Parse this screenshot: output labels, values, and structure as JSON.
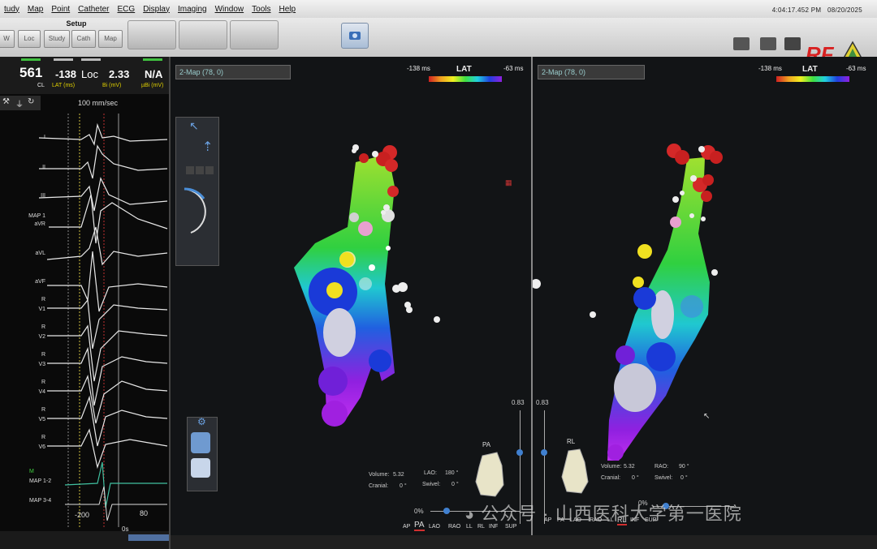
{
  "menu": [
    "tudy",
    "Map",
    "Point",
    "Catheter",
    "ECG",
    "Display",
    "Imaging",
    "Window",
    "Tools",
    "Help"
  ],
  "clock": {
    "time": "4:04:17.452 PM",
    "date": "08/20/2025"
  },
  "toolbar": {
    "setup_title": "Setup",
    "setup_buttons": [
      "W",
      "Loc",
      "Study",
      "Cath",
      "Map"
    ],
    "rf_logo": "RF"
  },
  "stats": {
    "cl": {
      "value": "561",
      "label": "CL"
    },
    "lat": {
      "value": "-138",
      "label": "LAT (ms)"
    },
    "loc": {
      "value": "Loc"
    },
    "bi": {
      "value": "2.33",
      "label": "Bi (mV)"
    },
    "ubi": {
      "value": "N/A",
      "label": "µBi (mV)"
    }
  },
  "ecg": {
    "speed": "100 mm/sec",
    "leads": [
      "I",
      "II",
      "III",
      "MAP 1",
      "aVR",
      "aVL",
      "aVF",
      "R",
      "V1",
      "R",
      "V2",
      "R",
      "V3",
      "R",
      "V4",
      "R",
      "V5",
      "R",
      "V6"
    ],
    "bottom_leads": [
      "M",
      "MAP 1-2",
      "MAP 3-4"
    ],
    "scale_left": "-200",
    "scale_right": "80",
    "scale_zero": "0s"
  },
  "map1": {
    "selector": "2-Map (78, 0)",
    "lat_left": "-138 ms",
    "lat_title": "LAT",
    "lat_right": "-63 ms",
    "volume_label": "Volume:",
    "volume": "5.32",
    "lao_label": "LAO:",
    "lao": "180 °",
    "cranial_label": "Cranial:",
    "cranial": "0 °",
    "swivel_label": "Swivel:",
    "swivel": "0 °",
    "orientation": "PA",
    "opacity_a": "0.83",
    "opacity_b": "0.83",
    "pct": "0%",
    "views": [
      "AP",
      "PA",
      "LAO",
      "RAO",
      "LL",
      "RL",
      "INF",
      "SUP"
    ]
  },
  "map2": {
    "selector": "2-Map (78, 0)",
    "lat_left": "-138 ms",
    "lat_title": "LAT",
    "lat_right": "-63 ms",
    "volume_label": "Volume:",
    "volume": "5.32",
    "rao_label": "RAO:",
    "rao": "90 °",
    "cranial_label": "Cranial:",
    "cranial": "0 °",
    "swivel_label": "Swivel:",
    "swivel": "0 °",
    "orientation": "RL",
    "pct": "0%",
    "views": [
      "AP",
      "PA",
      "LAO",
      "RAO",
      "LL",
      "RL",
      "INF",
      "SUP"
    ]
  },
  "watermark": "公众号 · 山西医科大学第一医院",
  "colors": {
    "lat_red": "#d02020",
    "lat_purple": "#9020e0",
    "rf_red": "#d82020",
    "lat_text": "#e0d000"
  }
}
